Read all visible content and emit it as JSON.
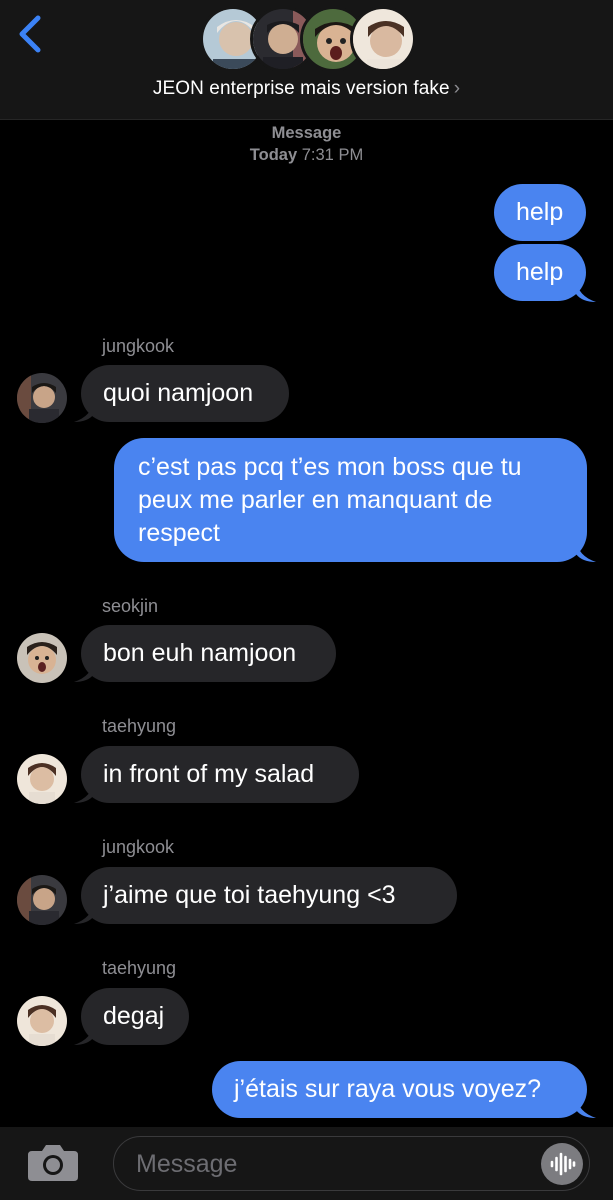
{
  "header": {
    "group_name": "JEON enterprise mais version fake",
    "chevron": "›",
    "avatars": [
      "namjoon",
      "jin",
      "jungkook",
      "taehyung"
    ]
  },
  "thread": {
    "service": "Message",
    "day": "Today",
    "time": "7:31 PM"
  },
  "messages": [
    {
      "from": "me",
      "text": "help"
    },
    {
      "from": "me",
      "text": "help"
    },
    {
      "sender": "jungkook",
      "text": "quoi namjoon"
    },
    {
      "from": "me",
      "text": "c’est pas pcq t’es mon boss que tu peux me parler en manquant de respect"
    },
    {
      "sender": "seokjin",
      "text": "bon euh namjoon"
    },
    {
      "sender": "taehyung",
      "text": "in front of my salad"
    },
    {
      "sender": "jungkook",
      "text": "j’aime que toi taehyung <3"
    },
    {
      "sender": "taehyung",
      "text": "degaj"
    },
    {
      "from": "me",
      "text": "j’étais sur raya vous voyez?"
    }
  ],
  "composer": {
    "placeholder": "Message"
  },
  "colors": {
    "outgoing_bubble": "#4a84f0",
    "incoming_bubble": "#262629",
    "accent": "#3b82f6"
  },
  "icons": [
    "back-chevron-icon",
    "camera-icon",
    "voice-waveform-icon"
  ]
}
